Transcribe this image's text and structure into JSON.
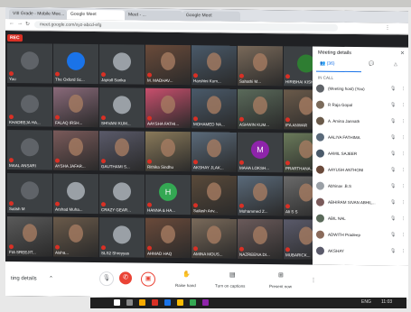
{
  "browser": {
    "tabs": [
      {
        "label": "VIII Grade - Mobile Mee..."
      },
      {
        "label": "Google Meet"
      },
      {
        "label": "Meet - ..."
      },
      {
        "label": "Google Meet"
      }
    ],
    "url": "meet.google.com/xyz-abcd-efg"
  },
  "meeting": {
    "rec_label": "REC",
    "tiles": [
      {
        "name": "You",
        "color": "#5f6368",
        "kind": "avatar"
      },
      {
        "name": "The Oxford Sc...",
        "color": "#1a73e8",
        "kind": "avatar"
      },
      {
        "name": "Jayroll Sarika",
        "color": "#9aa0a6",
        "kind": "avatar"
      },
      {
        "name": "M. MADHAV...",
        "color": "#6b4b3a",
        "kind": "video"
      },
      {
        "name": "Harshini Kum...",
        "color": "#4a5a6a",
        "kind": "video"
      },
      {
        "name": "Sahathi M...",
        "color": "#7a6a5a",
        "kind": "video"
      },
      {
        "name": "HIRIBHAI KISH...",
        "color": "#2e7d32",
        "kind": "avatar"
      },
      {
        "name": "KHADEEJA HA...",
        "color": "#5f6368",
        "kind": "avatar"
      },
      {
        "name": "FALAQ IRSH...",
        "color": "#8a6a7a",
        "kind": "video"
      },
      {
        "name": "SHIVANI KUM...",
        "color": "#9aa0a6",
        "kind": "avatar"
      },
      {
        "name": "AAYSHA FATHI...",
        "color": "#c94f6d",
        "kind": "video"
      },
      {
        "name": "MOHAMED NA...",
        "color": "#4a5a6a",
        "kind": "video"
      },
      {
        "name": "ASHWIN KUM...",
        "color": "#5a6a5a",
        "kind": "video"
      },
      {
        "name": "IFA ANWAR",
        "color": "#6a5a4a",
        "kind": "video"
      },
      {
        "name": "MAAL ANSARI",
        "color": "#5f6368",
        "kind": "avatar"
      },
      {
        "name": "AYSHA JAFAR...",
        "color": "#7a5a5a",
        "kind": "video"
      },
      {
        "name": "GAUTHAMI S...",
        "color": "#5a5a6a",
        "kind": "video"
      },
      {
        "name": "Rithika Sindhu",
        "color": "#8a7a5a",
        "kind": "video"
      },
      {
        "name": "AKSHAY JLAK...",
        "color": "#5a6a7a",
        "kind": "video"
      },
      {
        "name": "MAHA LOKSH...",
        "color": "#8e24aa",
        "kind": "letter",
        "letter": "M"
      },
      {
        "name": "PRARTHANA...",
        "color": "#6a7a5a",
        "kind": "video"
      },
      {
        "name": "Satish M",
        "color": "#5f6368",
        "kind": "avatar"
      },
      {
        "name": "Arshad Muha...",
        "color": "#9aa0a6",
        "kind": "avatar"
      },
      {
        "name": "CRAZY GEAR...",
        "color": "#9aa0a6",
        "kind": "avatar"
      },
      {
        "name": "HANNA & HA...",
        "color": "#34a853",
        "kind": "letter",
        "letter": "H"
      },
      {
        "name": "Sailash Ariv...",
        "color": "#5a4a3a",
        "kind": "video"
      },
      {
        "name": "Mohammed Z...",
        "color": "#5a6a7a",
        "kind": "video"
      },
      {
        "name": "Ali S S",
        "color": "#6a6a6a",
        "kind": "video"
      },
      {
        "name": "FIA SREEJIT...",
        "color": "#5a5a5a",
        "kind": "video"
      },
      {
        "name": "Aisha...",
        "color": "#6a5a4a",
        "kind": "video"
      },
      {
        "name": "SLS2 Shreyyas",
        "color": "#9aa0a6",
        "kind": "avatar"
      },
      {
        "name": "AHMAD HAQ",
        "color": "#6a4a3a",
        "kind": "video"
      },
      {
        "name": "AMINA MOUS...",
        "color": "#7a6a5a",
        "kind": "video"
      },
      {
        "name": "NAZREENA DI...",
        "color": "#6a5a5a",
        "kind": "video"
      },
      {
        "name": "MUBARICK...",
        "color": "#5a5a6a",
        "kind": "video"
      }
    ]
  },
  "controls": {
    "meeting_details": "ting details",
    "raise_hand": "Raise hand",
    "turn_on_captions": "Turn on captions",
    "present_now": "Present now"
  },
  "panel": {
    "title": "Meeting details",
    "tab_people": "(36)",
    "tab_chat": "",
    "section": "IN CALL",
    "participants": [
      {
        "name": "(Meeting host) (You)",
        "color": "#5f6368"
      },
      {
        "name": "R Raja Gopal",
        "color": "#7a6a5a"
      },
      {
        "name": "A. Amina Jannath",
        "color": "#6a5a4a"
      },
      {
        "name": "AALIYA FATHIMA",
        "color": "#5a6a7a"
      },
      {
        "name": "AAMIL SAJEER",
        "color": "#4a5a6a"
      },
      {
        "name": "AAYUSH ANTHONI",
        "color": "#6a4a3a"
      },
      {
        "name": "Abhinav .B.S",
        "color": "#9aa0a6"
      },
      {
        "name": "ABHIRAM SIVAN ABHIL...",
        "color": "#7a5a5a"
      },
      {
        "name": "ABIL NAL",
        "color": "#5a6a5a"
      },
      {
        "name": "ADWITH Pradeep",
        "color": "#8a6a5a"
      },
      {
        "name": "AKSHAY",
        "color": "#5a5a6a"
      }
    ]
  },
  "taskbar": {
    "language": "ENG",
    "time": "11:03"
  }
}
